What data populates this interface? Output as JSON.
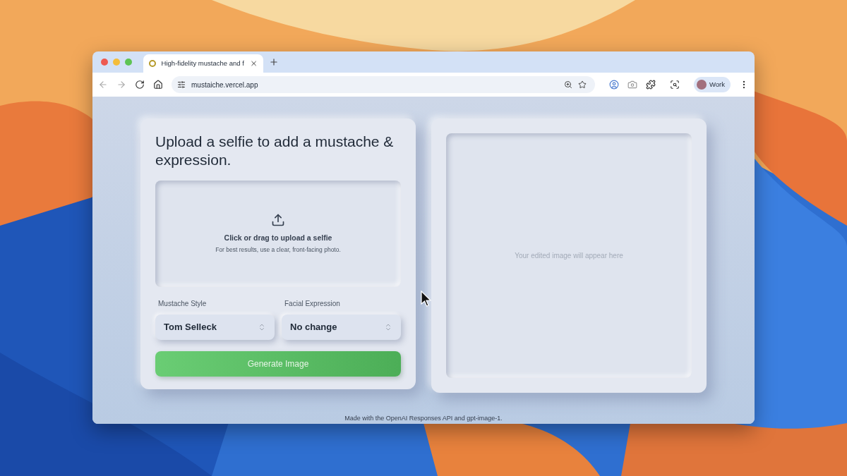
{
  "browser": {
    "tabs": [
      {
        "title": "High-fidelity mustache and f",
        "selected": true
      }
    ],
    "url": "mustaiche.vercel.app",
    "profile": "Work"
  },
  "upload_card": {
    "heading": "Upload a selfie to add a mustache & expression.",
    "dropzone": {
      "title": "Click or drag to upload a selfie",
      "hint": "For best results, use a clear, front-facing photo."
    },
    "selects": [
      {
        "label": "Mustache Style",
        "value": "Tom Selleck"
      },
      {
        "label": "Facial Expression",
        "value": "No change"
      }
    ],
    "generate_button": "Generate Image"
  },
  "result_card": {
    "placeholder": "Your edited image will appear here"
  },
  "footer": "Made with the OpenAI Responses API and gpt-image-1."
}
